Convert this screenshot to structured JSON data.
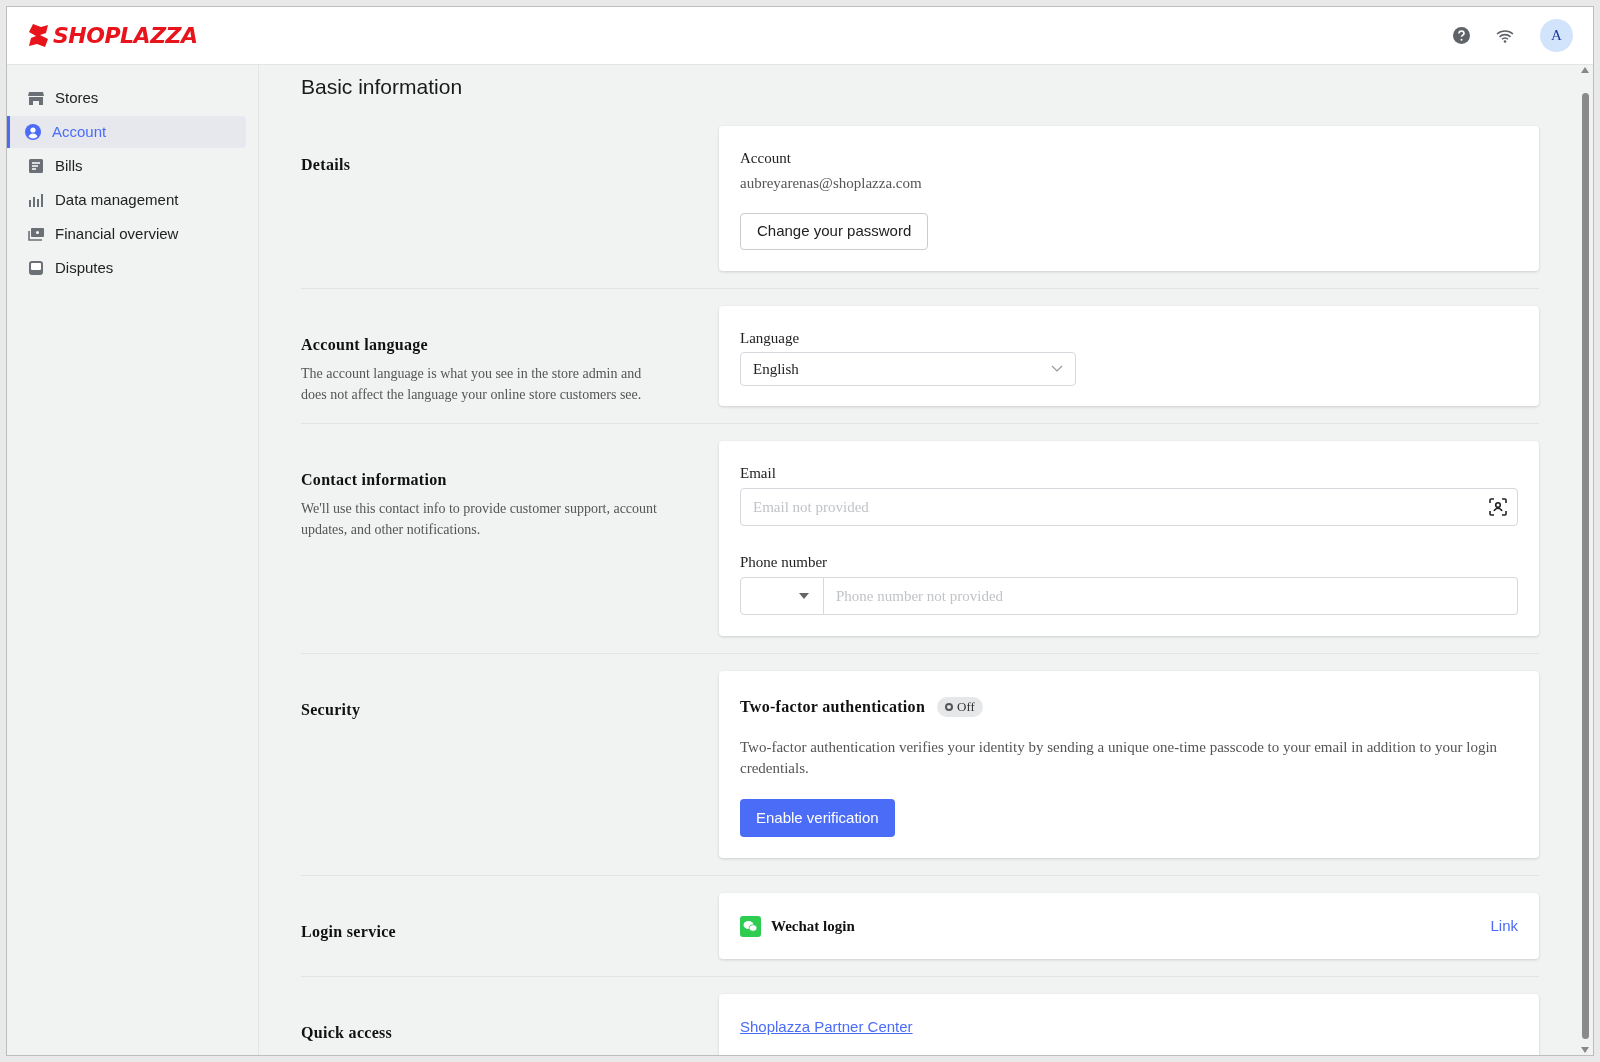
{
  "header": {
    "logo": "SHOPLAZZA",
    "avatar": "A"
  },
  "sidebar": {
    "items": [
      {
        "label": "Stores",
        "selected": false
      },
      {
        "label": "Account",
        "selected": true
      },
      {
        "label": "Bills",
        "selected": false
      },
      {
        "label": "Data management",
        "selected": false
      },
      {
        "label": "Financial overview",
        "selected": false
      },
      {
        "label": "Disputes",
        "selected": false
      }
    ]
  },
  "page_title": "Basic information",
  "sections": [
    {
      "kind": "account",
      "title": "Details",
      "label": "Account",
      "value": "aubreyarenas@shoplazza.com",
      "button": "Change your password"
    },
    {
      "kind": "select",
      "title": "Account language",
      "description": "The account language is what you see in the store admin and does not affect the language your online store customers see.",
      "label": "Language",
      "value": "English"
    },
    {
      "kind": "contact",
      "title": "Contact information",
      "description": "We'll use this contact info to provide customer support, account updates, and other notifications.",
      "email_label": "Email",
      "email_placeholder": "Email not provided",
      "phone_label": "Phone number",
      "phone_placeholder": "Phone number not provided"
    },
    {
      "kind": "two_factor",
      "title": "Security",
      "heading": "Two-factor authentication",
      "badge": "Off",
      "on": false,
      "body": "Two-factor authentication verifies your identity by sending a unique one-time passcode to your email in addition to your login credentials.",
      "button": "Enable verification"
    },
    {
      "kind": "login_service",
      "title": "Login service",
      "service": "Wechat login",
      "link": "Link"
    },
    {
      "kind": "links",
      "title": "Quick access",
      "links": [
        "Shoplazza Partner Center"
      ]
    }
  ]
}
